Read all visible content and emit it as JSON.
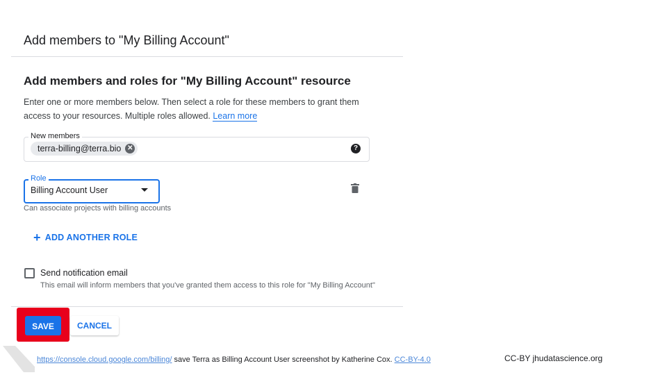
{
  "dialog": {
    "title": "Add members to \"My Billing Account\""
  },
  "section": {
    "title": "Add members and roles for \"My Billing Account\" resource",
    "description_line1": "Enter one or more members below. Then select a role for these members to grant them",
    "description_line2": "access to your resources. Multiple roles allowed.",
    "learn_more": "Learn more"
  },
  "members": {
    "label": "New members",
    "chip": "terra-billing@terra.bio",
    "help_glyph": "?"
  },
  "role": {
    "label": "Role",
    "value": "Billing Account User",
    "description": "Can associate projects with billing accounts"
  },
  "add_role": {
    "label": "ADD ANOTHER ROLE"
  },
  "notification": {
    "label": "Send notification email",
    "description": "This email will inform members that you've granted them access to this role for \"My Billing Account\"",
    "checked": false
  },
  "actions": {
    "save": "SAVE",
    "cancel": "CANCEL"
  },
  "footer": {
    "url": "https://console.cloud.google.com/billing/",
    "caption": " save Terra as Billing Account User  screenshot  by Katherine Cox. ",
    "license_link": "CC-BY-4.0",
    "license": "CC-BY  jhudatascience.org"
  },
  "colors": {
    "accent": "#1a73e8",
    "highlight": "#e8001c"
  }
}
